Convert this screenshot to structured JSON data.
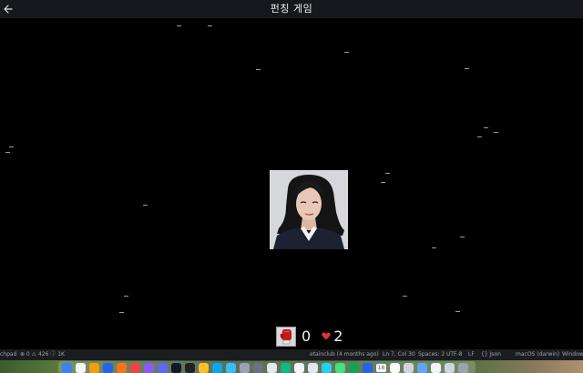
{
  "app": {
    "title": "펀칭 게임"
  },
  "icons": {
    "back": "arrow-left-icon",
    "glove": "boxing-glove-icon",
    "heart": "heart-icon"
  },
  "hud": {
    "score": "0",
    "lives": "2"
  },
  "colors": {
    "background": "#000000",
    "topbar": "#15181d",
    "heart": "#e0303a",
    "glove": "#c01a1a"
  },
  "statusbar": {
    "branch": "chpad",
    "problems": "⊗ 0 ⚠ 426 ⓘ 1K",
    "blame": "etainclub (4 months ago)",
    "cursor": "Ln 7, Col 30",
    "spaces": "Spaces: 2",
    "encoding": "UTF-8",
    "eol": "LF",
    "language": "{} Json",
    "platform": "macOS (darwin)",
    "window": "Windows"
  },
  "dock": {
    "calendar_day": "18"
  }
}
